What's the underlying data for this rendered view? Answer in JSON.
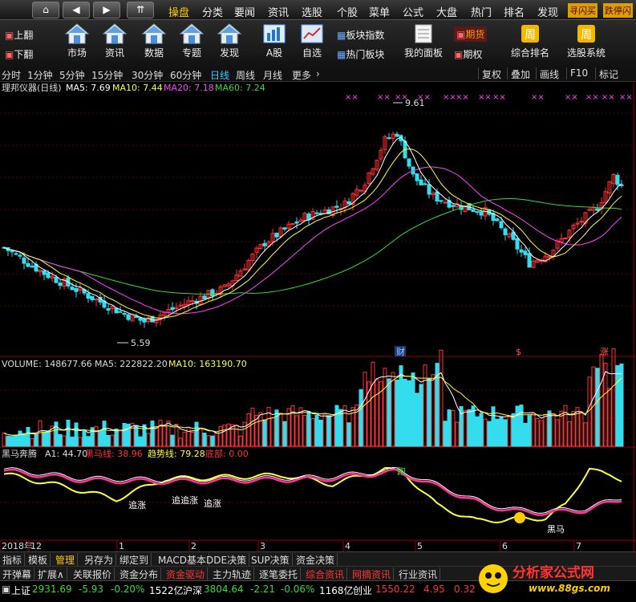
{
  "topbar": {
    "nav": [
      "⌂",
      "◀",
      "▶",
      "⇈"
    ],
    "menus": [
      "操盘",
      "分类",
      "要闻",
      "资讯",
      "选股",
      "个股",
      "菜单",
      "公式",
      "大盘",
      "热门",
      "排名",
      "发现"
    ],
    "active_menu": 0,
    "right_tags": [
      "寻闪买",
      "跌停闪"
    ]
  },
  "toolbar": {
    "page_up": "上翻",
    "page_down": "下翻",
    "buttons": [
      "市场",
      "资讯",
      "数据",
      "专题",
      "发现",
      "A股",
      "自选"
    ],
    "sector_index": "板块指数",
    "hot_sector": "热门板块",
    "my_panel": "我的面板",
    "futures": "期货",
    "options": "期权",
    "composite_rank": "综合排名",
    "stock_system": "选股系统",
    "week_icon": "周"
  },
  "periods": {
    "items": [
      "分时",
      "1分钟",
      "5分钟",
      "15分钟",
      "30分钟",
      "60分钟",
      "日线",
      "周线",
      "月线",
      "更多"
    ],
    "active": 6,
    "right": [
      "复权",
      "叠加",
      "画线",
      "F10",
      "标记"
    ]
  },
  "price_panel": {
    "title": "理邦仪器(日线)",
    "ma5_label": "MA5: 7.69",
    "ma10_label": "MA10: 7.44",
    "ma20_label": "MA20: 7.18",
    "ma60_label": "MA60: 7.24",
    "high_label": "9.61",
    "low_label": "5.59",
    "event_cai": "财",
    "event_dollar": "$",
    "event_zhang": "涨",
    "colors": {
      "ma5": "#ffffff",
      "ma10": "#ffff33",
      "ma20": "#ff44ff",
      "ma60": "#33dd33",
      "up": "#ff3333",
      "down": "#33ddee"
    }
  },
  "volume_panel": {
    "title": "VOLUME: 148677.66",
    "ma5_label": "MA5: 222822.20",
    "ma10_label": "MA10: 163190.70"
  },
  "indicator_panel": {
    "title": "黑马奔腾",
    "a1_label": "A1: 44.70",
    "hm_label": "黑马线: 38.96",
    "trend_label": "趋势线: 79.28",
    "bottom_label": "底部: 0.00",
    "zhuizhang_1": "追涨",
    "zhuizhang_2": "追追涨",
    "zhuizhang_3": "追涨",
    "pao_label": "跑",
    "heima_label": "黑马",
    "month_labels": [
      "2018年",
      "12",
      "1",
      "2",
      "3",
      "4",
      "5",
      "6",
      "7"
    ]
  },
  "bottom_tabs": {
    "row1": [
      "指标",
      "模板",
      "管理",
      "另存为",
      "绑定到",
      "MACD基本",
      "DDE决策",
      "SUP决策",
      "资金决策"
    ],
    "row1_active": 2,
    "row2": [
      "开弹幕",
      "扩展∧",
      "关联报价",
      "资金分布",
      "资金驱动",
      "主力轨迹",
      "逐笔委托",
      "综合资讯",
      "网摘资讯",
      "行业资讯"
    ]
  },
  "status": {
    "sh_name": "上证",
    "sh_value": "2931.69",
    "sh_change": "-5.93",
    "sh_pct": "-0.20%",
    "sh_amount": "1522亿",
    "sz_name": "沪深",
    "sz_value": "3804.64",
    "sz_change": "-2.21",
    "sz_pct": "-0.06%",
    "sz_amount": "1168亿",
    "cy_name": "创业",
    "cy_value": "1550.22",
    "cy_change": "4.95",
    "cy_pct": "0.32"
  },
  "watermark": {
    "title": "分析家公式网",
    "url": "www.88gs.com"
  }
}
